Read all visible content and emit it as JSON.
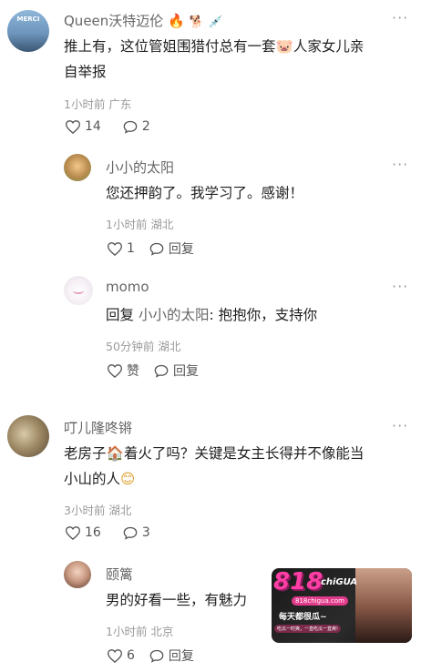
{
  "comments": [
    {
      "name": "Queen沃特迈伦",
      "text_line1": "推上有，这位管姐围猎付总有一套",
      "text_line2": "人家女儿亲",
      "text_line3": "自举报",
      "meta": "1小时前 广东",
      "likes": "14",
      "replies": "2",
      "avatar_label": "MERCI"
    },
    {
      "name": "小小的太阳",
      "text": "您还押韵了。我学习了。感谢！",
      "meta": "1小时前 湖北",
      "likes": "1",
      "reply_label": "回复"
    },
    {
      "name": "momo",
      "reply_prefix": "回复",
      "reply_target": "小小的太阳",
      "reply_text": ": 抱抱你，支持你",
      "meta": "50分钟前 湖北",
      "like_label": "赞",
      "reply_label": "回复"
    },
    {
      "name": "叮儿隆咚锵",
      "text_line1a": "老房子",
      "text_line1b": "着火了吗？关键是女主长得并不像能当",
      "text_line2": "小山的人",
      "meta": "3小时前 湖北",
      "likes": "16",
      "replies": "3"
    },
    {
      "name": "颐篱",
      "text": "男的好看一些，有魅力",
      "meta": "1小时前 北京",
      "likes": "6",
      "reply_label": "回复"
    }
  ],
  "watermark": {
    "logo": "818",
    "logo_sub": "chiGUA",
    "site": "818chigua.com",
    "slogan": "每天都很瓜~",
    "tag": "吃瓜一时爽，一直吃瓜一直爽!"
  }
}
